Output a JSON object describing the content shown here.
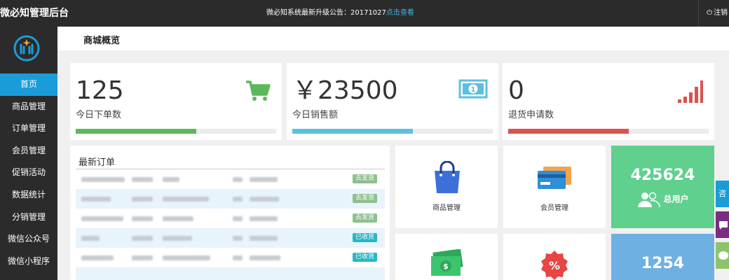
{
  "header": {
    "brand": "微必知管理后台",
    "notice_text": "微必知系统最新升级公告：20171027",
    "notice_link": "点击查看",
    "logout": "注销"
  },
  "sidebar": {
    "items": [
      {
        "label": "首页",
        "active": true
      },
      {
        "label": "商品管理"
      },
      {
        "label": "订单管理"
      },
      {
        "label": "会员管理"
      },
      {
        "label": "促销活动"
      },
      {
        "label": "数据统计"
      },
      {
        "label": "分销管理"
      },
      {
        "label": "微信公众号"
      },
      {
        "label": "微信小程序"
      }
    ]
  },
  "page": {
    "title": "商城概览"
  },
  "stats": [
    {
      "value": "125",
      "label": "今日下单数",
      "progress": 0.6,
      "color": "#5cb85c",
      "icon": "cart-icon"
    },
    {
      "value": "￥23500",
      "label": "今日销售额",
      "progress": 0.6,
      "color": "#5bc0de",
      "icon": "money-icon"
    },
    {
      "value": "0",
      "label": "退货申请数",
      "progress": 0.6,
      "color": "#d9534f",
      "icon": "signal-bars-icon"
    }
  ],
  "orders": {
    "title": "最新订单",
    "rows": [
      {
        "status": "去发货",
        "type": "pending"
      },
      {
        "status": "去发货",
        "type": "pending"
      },
      {
        "status": "去发货",
        "type": "pending"
      },
      {
        "status": "已收货",
        "type": "received"
      },
      {
        "status": "已收货",
        "type": "received"
      }
    ]
  },
  "tiles": {
    "goods": {
      "label": "商品管理",
      "icon": "shopping-bag-icon"
    },
    "members": {
      "label": "会员管理",
      "icon": "credit-card-icon"
    },
    "finance": {
      "icon": "cash-icon"
    },
    "promo": {
      "icon": "discount-badge-icon"
    }
  },
  "bigstats": {
    "users": {
      "value": "425624",
      "label": "总用户",
      "color": "#5fd08e"
    },
    "second": {
      "value": "1254",
      "color": "#6fb0e3"
    }
  },
  "float": {
    "tab1_text": "咨"
  },
  "colors": {
    "topbar": "#2b2b2b",
    "active_menu": "#1a9cd8"
  }
}
